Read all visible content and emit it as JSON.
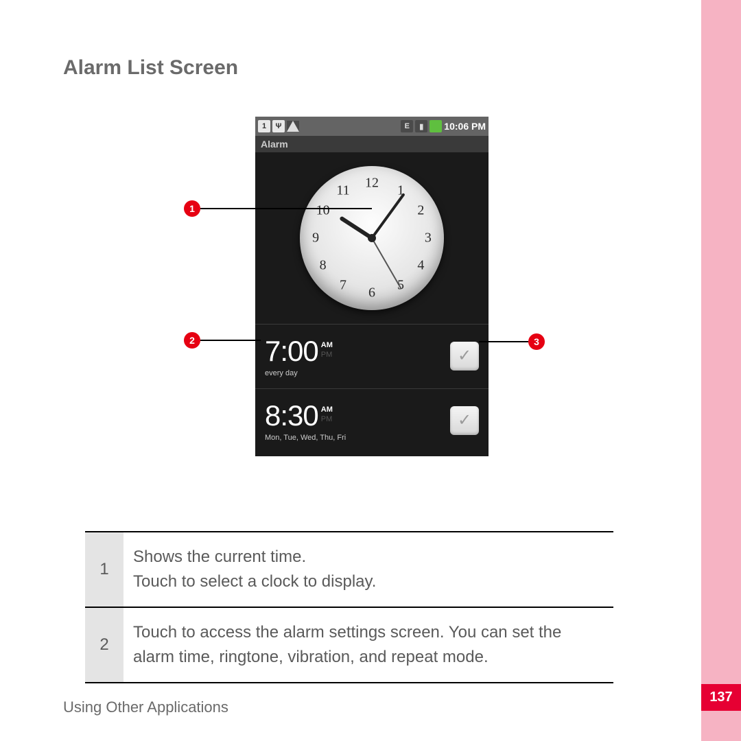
{
  "page": {
    "title": "Alarm List Screen",
    "footer": "Using Other Applications",
    "page_number": "137"
  },
  "phone": {
    "status_time": "10:06 PM",
    "app_title": "Alarm",
    "clock_numbers": [
      "12",
      "1",
      "2",
      "3",
      "4",
      "5",
      "6",
      "7",
      "8",
      "9",
      "10",
      "11"
    ],
    "alarms": [
      {
        "time": "7:00",
        "am": "AM",
        "pm": "PM",
        "repeat": "every day"
      },
      {
        "time": "8:30",
        "am": "AM",
        "pm": "PM",
        "repeat": "Mon, Tue, Wed, Thu, Fri"
      }
    ]
  },
  "callouts": {
    "c1": "1",
    "c2": "2",
    "c3": "3"
  },
  "table": {
    "rows": [
      {
        "num": "1",
        "desc": "Shows the current time.\nTouch to select a clock to display."
      },
      {
        "num": "2",
        "desc": "Touch to access the alarm settings screen. You can set the alarm time, ringtone, vibration, and repeat mode."
      }
    ]
  }
}
